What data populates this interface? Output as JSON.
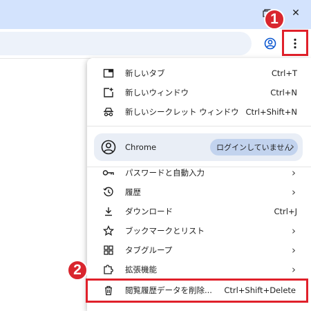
{
  "window": {
    "maximize_icon": "restore-icon",
    "close_glyph": "✕"
  },
  "badges": {
    "one": "1",
    "two": "2"
  },
  "menu": {
    "items_top": [
      {
        "label": "新しいタブ",
        "shortcut": "Ctrl+T",
        "icon": "new-tab-icon"
      },
      {
        "label": "新しいウィンドウ",
        "shortcut": "Ctrl+N",
        "icon": "new-window-icon"
      },
      {
        "label": "新しいシークレット ウィンドウ",
        "shortcut": "Ctrl+Shift+N",
        "icon": "incognito-icon"
      }
    ],
    "profile": {
      "name": "Chrome",
      "status": "ログインしていません"
    },
    "items_bottom": [
      {
        "label": "パスワードと自動入力",
        "icon": "key-icon"
      },
      {
        "label": "履歴",
        "icon": "history-icon"
      },
      {
        "label": "ダウンロード",
        "shortcut": "Ctrl+J",
        "icon": "download-icon"
      },
      {
        "label": "ブックマークとリスト",
        "icon": "star-icon"
      },
      {
        "label": "タブグループ",
        "icon": "tab-groups-icon"
      },
      {
        "label": "拡張機能",
        "icon": "extension-icon"
      },
      {
        "label": "閲覧履歴データを削除...",
        "shortcut": "Ctrl+Shift+Delete",
        "icon": "trash-icon"
      }
    ],
    "chevron": "›"
  },
  "colors": {
    "accent_red": "#e0202a",
    "titlebar": "#d3e3fd"
  }
}
